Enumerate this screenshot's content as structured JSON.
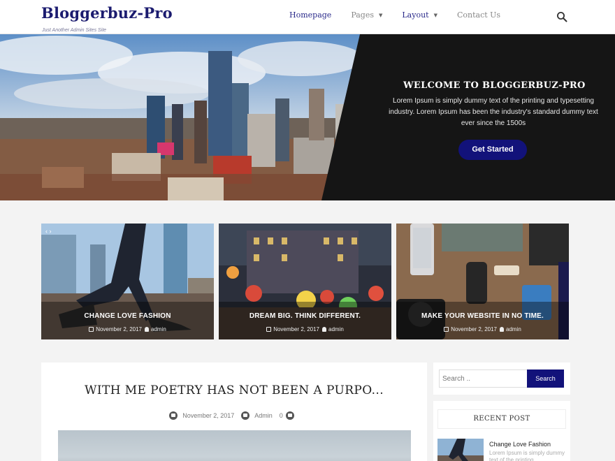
{
  "site": {
    "title": "Bloggerbuz-Pro",
    "tagline": "Just Another Admin Sites Site"
  },
  "nav": {
    "items": [
      {
        "label": "Homepage",
        "active": true,
        "has_dropdown": false
      },
      {
        "label": "Pages",
        "active": false,
        "has_dropdown": true
      },
      {
        "label": "Layout",
        "active": true,
        "has_dropdown": true
      },
      {
        "label": "Contact Us",
        "active": false,
        "has_dropdown": false
      }
    ],
    "search_icon": "search-icon"
  },
  "hero": {
    "title": "WELCOME TO BLOGGERBUZ-PRO",
    "text": "Lorem Ipsum is simply dummy text of the printing and typesetting industry. Lorem Ipsum has been the industry's standard dummy text ever since the 1500s",
    "button_label": "Get Started",
    "accent_color": "#12127a"
  },
  "cards": [
    {
      "title": "CHANGE LOVE FASHION",
      "date": "November 2, 2017",
      "author": "admin"
    },
    {
      "title": "DREAM BIG. THINK DIFFERENT.",
      "date": "November 2, 2017",
      "author": "admin"
    },
    {
      "title": "MAKE YOUR WEBSITE IN NO TIME.",
      "date": "November 2, 2017",
      "author": "admin"
    }
  ],
  "post": {
    "title": "WITH ME POETRY HAS NOT BEEN A PURPO...",
    "date": "November 2, 2017",
    "author": "Admin",
    "comments": "0"
  },
  "sidebar": {
    "search_placeholder": "Search ..",
    "search_button": "Search",
    "recent_heading": "RECENT POST",
    "recent_items": [
      {
        "title": "Change Love Fashion",
        "excerpt": "Lorem Ipsum is simply dummy text of the printing"
      }
    ]
  }
}
